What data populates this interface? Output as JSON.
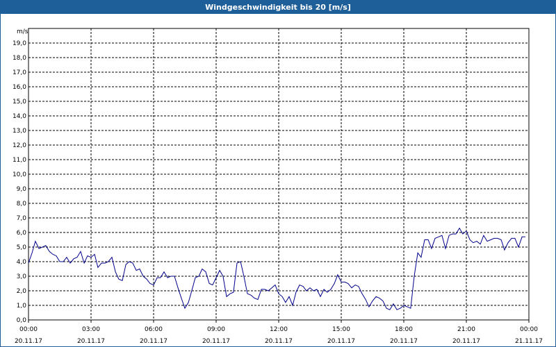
{
  "window": {
    "title": "Windgeschwindigkeit bis 20 [m/s]"
  },
  "chart_data": {
    "type": "line",
    "title": "Windgeschwindigkeit bis 20 [m/s]",
    "ylabel": "m/s",
    "xlabel": "",
    "ylim": [
      0,
      20
    ],
    "xlim_hours": [
      0,
      24
    ],
    "grid": true,
    "y_ticks": [
      "0,0",
      "1,0",
      "2,0",
      "3,0",
      "4,0",
      "5,0",
      "6,0",
      "7,0",
      "8,0",
      "9,0",
      "10,0",
      "11,0",
      "12,0",
      "13,0",
      "14,0",
      "15,0",
      "16,0",
      "17,0",
      "18,0",
      "19,0"
    ],
    "x_ticks": [
      {
        "time": "00:00",
        "date": "20.11.17"
      },
      {
        "time": "03:00",
        "date": "20.11.17"
      },
      {
        "time": "06:00",
        "date": "20.11.17"
      },
      {
        "time": "09:00",
        "date": "20.11.17"
      },
      {
        "time": "12:00",
        "date": "20.11.17"
      },
      {
        "time": "15:00",
        "date": "20.11.17"
      },
      {
        "time": "18:00",
        "date": "20.11.17"
      },
      {
        "time": "21:00",
        "date": "20.11.17"
      },
      {
        "time": "00:00",
        "date": "21.11.17"
      }
    ],
    "series": [
      {
        "color": "#00008b",
        "x_hours": [
          0.0,
          0.17,
          0.33,
          0.5,
          0.67,
          0.83,
          1.0,
          1.17,
          1.33,
          1.5,
          1.67,
          1.83,
          2.0,
          2.17,
          2.33,
          2.5,
          2.67,
          2.83,
          3.0,
          3.17,
          3.33,
          3.5,
          3.67,
          3.83,
          4.0,
          4.17,
          4.33,
          4.5,
          4.67,
          4.83,
          5.0,
          5.17,
          5.33,
          5.5,
          5.67,
          5.83,
          6.0,
          6.17,
          6.33,
          6.5,
          6.67,
          6.83,
          7.0,
          7.17,
          7.33,
          7.5,
          7.67,
          7.83,
          8.0,
          8.17,
          8.33,
          8.5,
          8.67,
          8.83,
          9.0,
          9.17,
          9.33,
          9.5,
          9.67,
          9.83,
          10.0,
          10.17,
          10.33,
          10.5,
          10.67,
          10.83,
          11.0,
          11.17,
          11.33,
          11.5,
          11.67,
          11.83,
          12.0,
          12.17,
          12.33,
          12.5,
          12.67,
          12.83,
          13.0,
          13.17,
          13.33,
          13.5,
          13.67,
          13.83,
          14.0,
          14.17,
          14.33,
          14.5,
          14.67,
          14.83,
          15.0,
          15.17,
          15.33,
          15.5,
          15.67,
          15.83,
          16.0,
          16.17,
          16.33,
          16.5,
          16.67,
          16.83,
          17.0,
          17.17,
          17.33,
          17.5,
          17.67,
          17.83,
          18.0,
          18.17,
          18.33,
          18.5,
          18.67,
          18.83,
          19.0,
          19.17,
          19.33,
          19.5,
          19.67,
          19.83,
          20.0,
          20.17,
          20.33,
          20.5,
          20.67,
          20.83,
          21.0,
          21.17,
          21.33,
          21.5,
          21.67,
          21.83,
          22.0,
          22.17,
          22.33,
          22.5,
          22.67,
          22.83,
          23.0,
          23.17,
          23.33,
          23.5,
          23.67,
          23.83
        ],
        "values": [
          3.9,
          4.6,
          5.4,
          4.9,
          5.0,
          5.1,
          4.7,
          4.5,
          4.4,
          4.0,
          4.0,
          4.3,
          3.9,
          4.2,
          4.3,
          4.7,
          3.9,
          4.4,
          4.3,
          4.5,
          3.6,
          3.9,
          3.9,
          4.0,
          4.3,
          3.3,
          2.8,
          2.7,
          3.8,
          4.0,
          3.9,
          3.4,
          3.5,
          3.0,
          2.8,
          2.5,
          2.4,
          2.9,
          2.9,
          3.3,
          2.9,
          3.0,
          3.0,
          2.2,
          1.5,
          0.8,
          1.2,
          2.0,
          2.9,
          3.0,
          3.5,
          3.3,
          2.5,
          2.4,
          2.9,
          3.4,
          3.0,
          1.6,
          1.8,
          1.9,
          3.9,
          4.0,
          3.0,
          1.8,
          1.7,
          1.5,
          1.4,
          2.1,
          2.1,
          2.0,
          2.2,
          2.4,
          1.8,
          1.6,
          1.2,
          1.6,
          1.0,
          1.9,
          2.4,
          2.3,
          2.0,
          2.2,
          2.0,
          2.1,
          1.6,
          2.1,
          1.9,
          2.1,
          2.5,
          3.1,
          2.6,
          2.6,
          2.5,
          2.2,
          2.4,
          2.3,
          1.8,
          1.4,
          0.9,
          1.3,
          1.6,
          1.5,
          1.3,
          0.8,
          0.7,
          1.1,
          0.7,
          0.8,
          1.0,
          0.9,
          0.8,
          3.0,
          4.6,
          4.3,
          5.5,
          5.5,
          4.9,
          5.6,
          5.7,
          5.8,
          4.9,
          5.8,
          5.9,
          5.9,
          6.3,
          5.9,
          6.1,
          5.5,
          5.3,
          5.4,
          5.2,
          5.8,
          5.4,
          5.5,
          5.6,
          5.6,
          5.5,
          4.8,
          5.3,
          5.6,
          5.6,
          5.0,
          5.7,
          5.7
        ]
      }
    ]
  }
}
